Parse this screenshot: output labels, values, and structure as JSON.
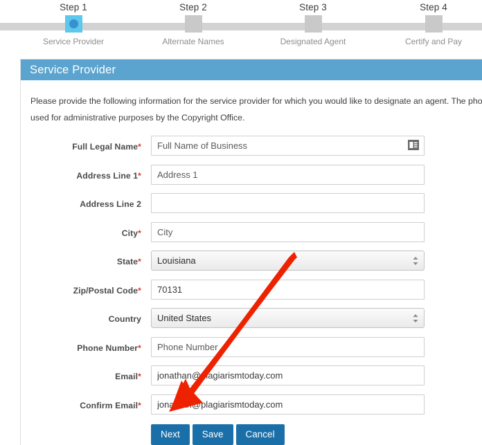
{
  "stepper": {
    "steps": [
      {
        "title": "Step 1",
        "label": "Service Provider",
        "state": "active"
      },
      {
        "title": "Step 2",
        "label": "Alternate Names",
        "state": "inactive"
      },
      {
        "title": "Step 3",
        "label": "Designated Agent",
        "state": "inactive"
      },
      {
        "title": "Step 4",
        "label": "Certify and Pay",
        "state": "inactive"
      }
    ],
    "active_color": "#5bc8ec",
    "active_dot_color": "#3a8fd0",
    "inactive_color": "#c9c9c9",
    "track_color": "#d3d3d3"
  },
  "panel": {
    "header_title": "Service Provider",
    "header_color": "#5ba4cf",
    "intro_line1": "Please provide the following information for the service provider for which you would like to designate an agent. The phone number and e",
    "intro_line2": "used for administrative purposes by the Copyright Office."
  },
  "form": {
    "fields": [
      {
        "label": "Full Legal Name",
        "required": true,
        "type": "text",
        "value": "",
        "placeholder": "Full Name of Business",
        "icon": "contact-card-icon"
      },
      {
        "label": "Address Line 1",
        "required": true,
        "type": "text",
        "value": "",
        "placeholder": "Address 1"
      },
      {
        "label": "Address Line 2",
        "required": false,
        "type": "text",
        "value": "",
        "placeholder": ""
      },
      {
        "label": "City",
        "required": true,
        "type": "text",
        "value": "",
        "placeholder": "City"
      },
      {
        "label": "State",
        "required": true,
        "type": "select",
        "value": "Louisiana"
      },
      {
        "label": "Zip/Postal Code",
        "required": true,
        "type": "text",
        "value": "70131",
        "placeholder": ""
      },
      {
        "label": "Country",
        "required": false,
        "type": "select",
        "value": "United States"
      },
      {
        "label": "Phone Number",
        "required": true,
        "type": "text",
        "value": "",
        "placeholder": "Phone Number"
      },
      {
        "label": "Email",
        "required": true,
        "type": "text",
        "value": "jonathan@plagiarismtoday.com",
        "placeholder": ""
      },
      {
        "label": "Confirm Email",
        "required": true,
        "type": "text",
        "value": "jonathan@plagiarismtoday.com",
        "placeholder": ""
      }
    ],
    "required_marker": "*",
    "buttons": [
      {
        "label": "Next",
        "name": "next-button"
      },
      {
        "label": "Save",
        "name": "save-button"
      },
      {
        "label": "Cancel",
        "name": "cancel-button"
      }
    ],
    "button_color": "#1b6fa8"
  },
  "annotation": {
    "arrow_color": "#ee2200",
    "points_to": "Next"
  }
}
